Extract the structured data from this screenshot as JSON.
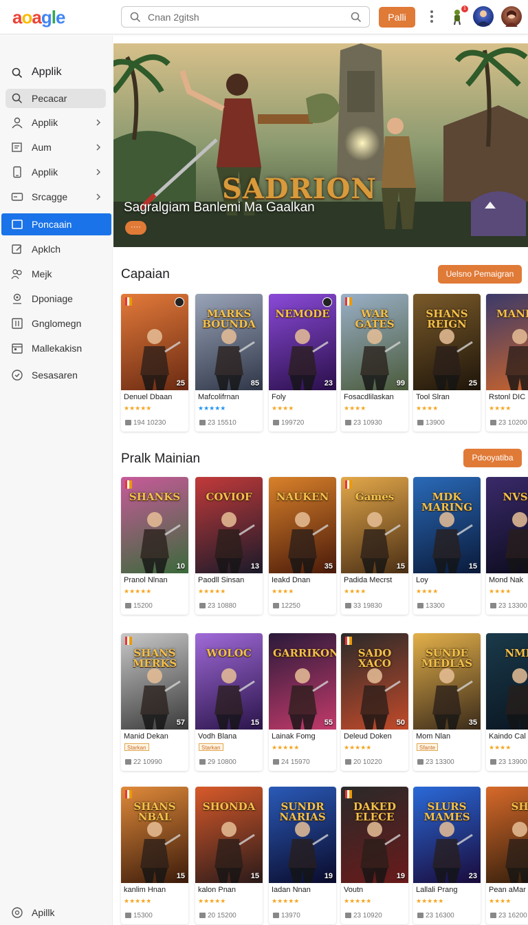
{
  "header": {
    "logo": "aoagle",
    "search_placeholder": "Cnan 2gitsh",
    "primary_button": "Palli",
    "notification_count": "1"
  },
  "sidebar": {
    "items": [
      {
        "label": "Applik",
        "icon": "search-icon",
        "style": "head"
      },
      {
        "label": "Pecacar",
        "icon": "search-icon",
        "style": "hover"
      },
      {
        "label": "Applik",
        "icon": "person-icon",
        "chevron": true
      },
      {
        "label": "Aum",
        "icon": "inbox-icon",
        "chevron": true
      },
      {
        "label": "Applik",
        "icon": "phone-icon",
        "chevron": true
      },
      {
        "label": "Srcagge",
        "icon": "storage-icon",
        "chevron": true
      },
      {
        "label": "Poncaain",
        "icon": "square-icon",
        "style": "active"
      },
      {
        "label": "Apklch",
        "icon": "edit-icon"
      },
      {
        "label": "Mejk",
        "icon": "group-icon"
      },
      {
        "label": "Dponiage",
        "icon": "location-icon"
      },
      {
        "label": "Gnglomegn",
        "icon": "grid-icon"
      },
      {
        "label": "Mallekakisn",
        "icon": "calendar-icon"
      },
      {
        "label": "Sesasaren",
        "icon": "clock-icon"
      }
    ],
    "footer_item": {
      "label": "Apillk",
      "icon": "help-icon"
    }
  },
  "hero": {
    "title": "Sagralgiam Banlemi Ma Gaalkan",
    "logo_text": "SADRION",
    "pill": "····"
  },
  "sections": [
    {
      "title": "Capaian",
      "button": "Uelsno Pemaigran",
      "cards": [
        {
          "art_title": "",
          "num": "25",
          "name": "Denuel Dbaan",
          "rating": "★★★★★",
          "meta": "194 10230"
        },
        {
          "art_title": "MARKS BOUNDA",
          "num": "85",
          "name": "Mafcolifrnan",
          "rating": "★★★★★",
          "meta": "23 15510"
        },
        {
          "art_title": "NEMODE",
          "num": "23",
          "name": "Foly",
          "rating": "★★★★",
          "meta": "199720"
        },
        {
          "art_title": "WAR GATES",
          "num": "99",
          "name": "Fosacdlilaskan",
          "rating": "★★★★",
          "meta": "23 10930"
        },
        {
          "art_title": "SHANS REIGN",
          "num": "25",
          "name": "Tool Slran",
          "rating": "★★★★",
          "meta": "13900"
        },
        {
          "art_title": "MANDU",
          "num": "",
          "name": "Rstonl DIC",
          "rating": "★★★★",
          "meta": "23 10200"
        }
      ]
    },
    {
      "title": "Pralk Mainian",
      "button": "Pdooyatiba",
      "cards": [
        {
          "art_title": "SHANKS",
          "num": "10",
          "name": "Pranol Nlnan",
          "rating": "★★★★★",
          "meta": "15200"
        },
        {
          "art_title": "COVIOF",
          "num": "13",
          "name": "Paodll Sinsan",
          "rating": "★★★★★",
          "meta": "23 10880"
        },
        {
          "art_title": "NAUKEN",
          "num": "35",
          "name": "Ieakd Dnan",
          "rating": "★★★★",
          "meta": "12250"
        },
        {
          "art_title": "Games",
          "num": "15",
          "name": "Padida Mecrst",
          "rating": "★★★★",
          "meta": "33 19830"
        },
        {
          "art_title": "MDK MARING",
          "num": "15",
          "name": "Loy",
          "rating": "★★★★",
          "meta": "13300"
        },
        {
          "art_title": "NVSK",
          "num": "",
          "name": "Mond Nak",
          "rating": "★★★★",
          "meta": "23 13300"
        }
      ]
    },
    {
      "title": "",
      "button": "",
      "cards": [
        {
          "art_title": "SHANS MERKS",
          "num": "57",
          "name": "Manid Dekan",
          "tag": "Starkan",
          "meta": "22 10990"
        },
        {
          "art_title": "WOLOC",
          "num": "15",
          "name": "Vodh Blana",
          "tag": "Starkan",
          "meta": "29 10800"
        },
        {
          "art_title": "GARRIKON",
          "num": "55",
          "name": "Lainak Fomg",
          "rating": "★★★★★",
          "meta": "24 15970"
        },
        {
          "art_title": "SADO XACO",
          "num": "50",
          "name": "Deleud Doken",
          "rating": "★★★★★",
          "meta": "20 10220"
        },
        {
          "art_title": "SUNDE MEDLAS",
          "num": "35",
          "name": "Mom Nlan",
          "tag": "Sfante",
          "meta": "23 13300"
        },
        {
          "art_title": "NMK",
          "num": "",
          "name": "Kaindo Cal",
          "rating": "★★★★",
          "meta": "23 13900"
        }
      ]
    },
    {
      "title": "",
      "button": "",
      "cards": [
        {
          "art_title": "SHANS NBAL",
          "num": "15",
          "name": "kanlim Hnan",
          "rating": "★★★★★",
          "meta": "15300"
        },
        {
          "art_title": "SHONDA",
          "num": "15",
          "name": "kalon Pnan",
          "rating": "★★★★★",
          "meta": "20 15200"
        },
        {
          "art_title": "SUNDR NARIAS",
          "num": "19",
          "name": "Iadan Nnan",
          "rating": "★★★★★",
          "meta": "13970"
        },
        {
          "art_title": "DAKED ELECE",
          "num": "19",
          "name": "Voutn",
          "rating": "★★★★★",
          "meta": "23 10920"
        },
        {
          "art_title": "SLURS MAMES",
          "num": "23",
          "name": "Lallali Prang",
          "rating": "★★★★★",
          "meta": "23 16300"
        },
        {
          "art_title": "SH",
          "num": "",
          "name": "Pean aMar",
          "rating": "★★★★",
          "meta": "23 16200"
        }
      ]
    }
  ],
  "colors": {
    "accent": "#e07a37",
    "active_nav": "#1a73e8"
  }
}
